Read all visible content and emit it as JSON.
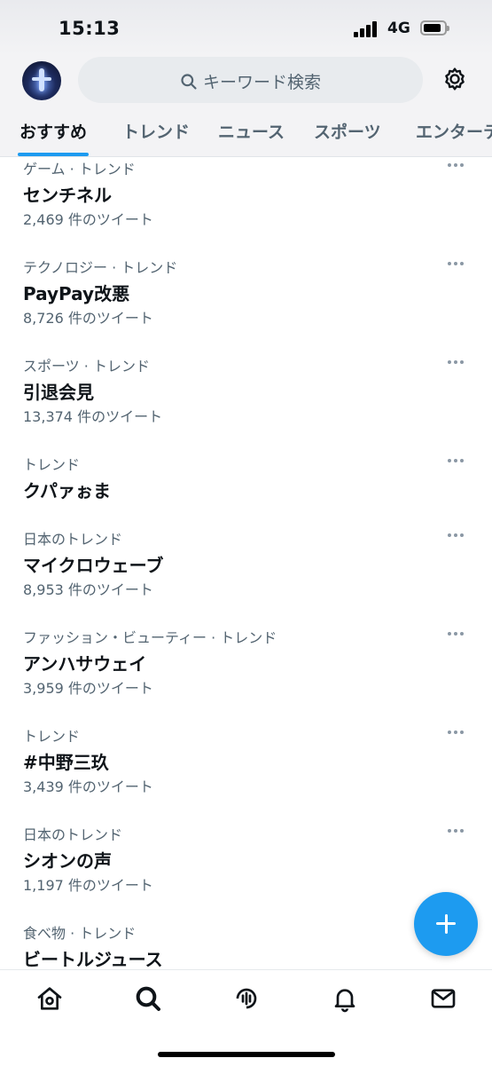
{
  "status_bar": {
    "time": "15:13",
    "network": "4G"
  },
  "header": {
    "search_placeholder": "キーワード検索"
  },
  "tabs": [
    {
      "label": "おすすめ",
      "active": true
    },
    {
      "label": "トレンド"
    },
    {
      "label": "ニュース"
    },
    {
      "label": "スポーツ"
    },
    {
      "label": "エンターテ"
    }
  ],
  "trends": [
    {
      "category": "ゲーム · トレンド",
      "title": "センチネル",
      "count": "2,469 件のツイート"
    },
    {
      "category": "テクノロジー · トレンド",
      "title": "PayPay改悪",
      "count": "8,726 件のツイート"
    },
    {
      "category": "スポーツ · トレンド",
      "title": "引退会見",
      "count": "13,374 件のツイート"
    },
    {
      "category": "トレンド",
      "title": "クパァぉま",
      "count": ""
    },
    {
      "category": "日本のトレンド",
      "title": "マイクロウェーブ",
      "count": "8,953 件のツイート"
    },
    {
      "category": "ファッション・ビューティー · トレンド",
      "title": "アンハサウェイ",
      "count": "3,959 件のツイート"
    },
    {
      "category": "トレンド",
      "title": "#中野三玖",
      "count": "3,439 件のツイート"
    },
    {
      "category": "日本のトレンド",
      "title": "シオンの声",
      "count": "1,197 件のツイート"
    },
    {
      "category": "食べ物 · トレンド",
      "title": "ビートルジュース",
      "count": ""
    }
  ],
  "icons": {
    "search": "search-icon",
    "settings": "gear-icon",
    "more": "more-icon",
    "compose": "plus-icon",
    "nav": [
      "home-icon",
      "search-icon",
      "spaces-icon",
      "bell-icon",
      "mail-icon"
    ]
  },
  "colors": {
    "accent": "#1d9bf0",
    "text": "#0f1419",
    "secondary": "#536471"
  }
}
